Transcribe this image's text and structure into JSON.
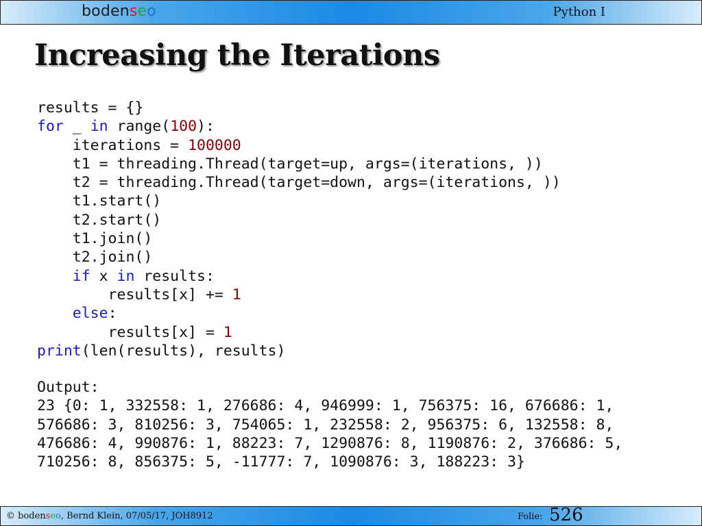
{
  "header": {
    "brand_base": "boden",
    "brand_s": "s",
    "brand_e": "e",
    "brand_o": "o",
    "course": "Python I"
  },
  "slide": {
    "title": "Increasing the Iterations"
  },
  "code": {
    "l1": "results = {}",
    "l2_kw_for": "for",
    "l2_mid": " _ ",
    "l2_kw_in": "in",
    "l2_rest1": " range(",
    "l2_num": "100",
    "l2_rest2": "):",
    "l3_pre": "    iterations = ",
    "l3_num": "100000",
    "l4": "    t1 = threading.Thread(target=up, args=(iterations, ))",
    "l5": "    t2 = threading.Thread(target=down, args=(iterations, ))",
    "l6": "    t1.start()",
    "l7": "    t2.start()",
    "l8": "    t1.join()",
    "l9": "    t2.join()",
    "l10_pre": "    ",
    "l10_kw_if": "if",
    "l10_mid": " x ",
    "l10_kw_in": "in",
    "l10_rest": " results:",
    "l11_pre": "        results[x] += ",
    "l11_num": "1",
    "l12_pre": "    ",
    "l12_kw_else": "else",
    "l12_rest": ":",
    "l13_pre": "        results[x] = ",
    "l13_num": "1",
    "l14_kw_print": "print",
    "l14_rest": "(len(results), results)"
  },
  "output": {
    "label": "Output:",
    "line1": "23 {0: 1, 332558: 1, 276686: 4, 946999: 1, 756375: 16, 676686: 1,",
    "line2": "576686: 3, 810256: 3, 754065: 1, 232558: 2, 956375: 6, 132558: 8,",
    "line3": "476686: 4, 990876: 1, 88223: 7, 1290876: 8, 1190876: 2, 376686: 5,",
    "line4": "710256: 8, 856375: 5, -11777: 7, 1090876: 3, 188223: 3}"
  },
  "footer": {
    "copy_symbol": "©",
    "brand_base": " boden",
    "brand_s": "s",
    "brand_e": "e",
    "brand_o": "o",
    "author_info": ", Bernd Klein, 07/05/17, JOH8912",
    "folie_label": "Folie:",
    "folie_number": "526"
  },
  "colors": {
    "keyword": "#1a1acc",
    "number": "#8b0000",
    "bar_center": "#1a8ae6",
    "brand_s": "#d2143a",
    "brand_e": "#2aa13a",
    "brand_o": "#1f6fd8"
  }
}
